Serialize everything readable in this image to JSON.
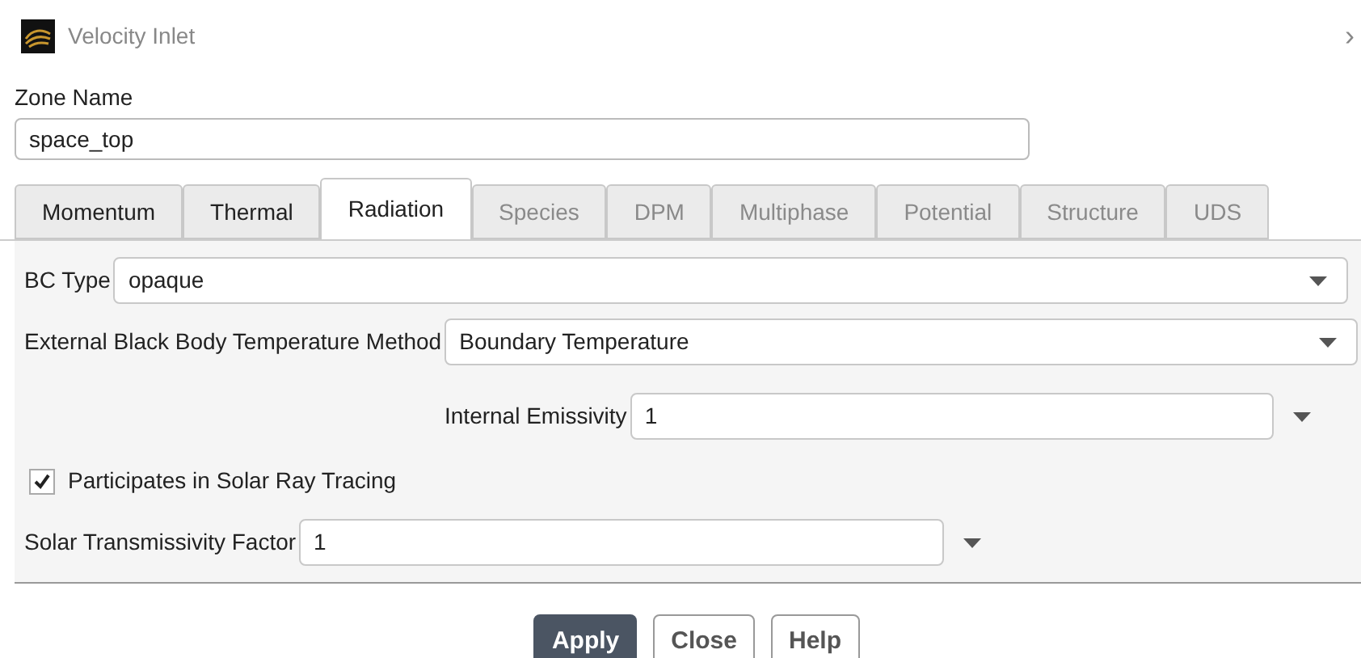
{
  "window": {
    "title": "Velocity Inlet",
    "close": "›"
  },
  "zone_name": {
    "label": "Zone Name",
    "value": "space_top"
  },
  "tabs": [
    {
      "label": "Momentum",
      "selected": false,
      "disabled": false
    },
    {
      "label": "Thermal",
      "selected": false,
      "disabled": false
    },
    {
      "label": "Radiation",
      "selected": true,
      "disabled": false
    },
    {
      "label": "Species",
      "selected": false,
      "disabled": true
    },
    {
      "label": "DPM",
      "selected": false,
      "disabled": true
    },
    {
      "label": "Multiphase",
      "selected": false,
      "disabled": true
    },
    {
      "label": "Potential",
      "selected": false,
      "disabled": true
    },
    {
      "label": "Structure",
      "selected": false,
      "disabled": true
    },
    {
      "label": "UDS",
      "selected": false,
      "disabled": true
    }
  ],
  "fields": [
    {
      "kind": "dropdown",
      "label": "BC Type",
      "value": "opaque"
    },
    {
      "kind": "dropdown",
      "label": "External Black Body Temperature Method",
      "value": "Boundary Temperature"
    },
    {
      "kind": "parameter",
      "label": "Internal Emissivity",
      "value": "1"
    },
    {
      "kind": "checkbox",
      "label": "Participates in Solar Ray Tracing",
      "checked": true
    },
    {
      "kind": "parameter",
      "label": "Solar Transmissivity Factor",
      "value": "1"
    }
  ],
  "buttons": [
    {
      "label": "Apply",
      "primary": true
    },
    {
      "label": "Close",
      "primary": false
    },
    {
      "label": "Help",
      "primary": false
    }
  ]
}
